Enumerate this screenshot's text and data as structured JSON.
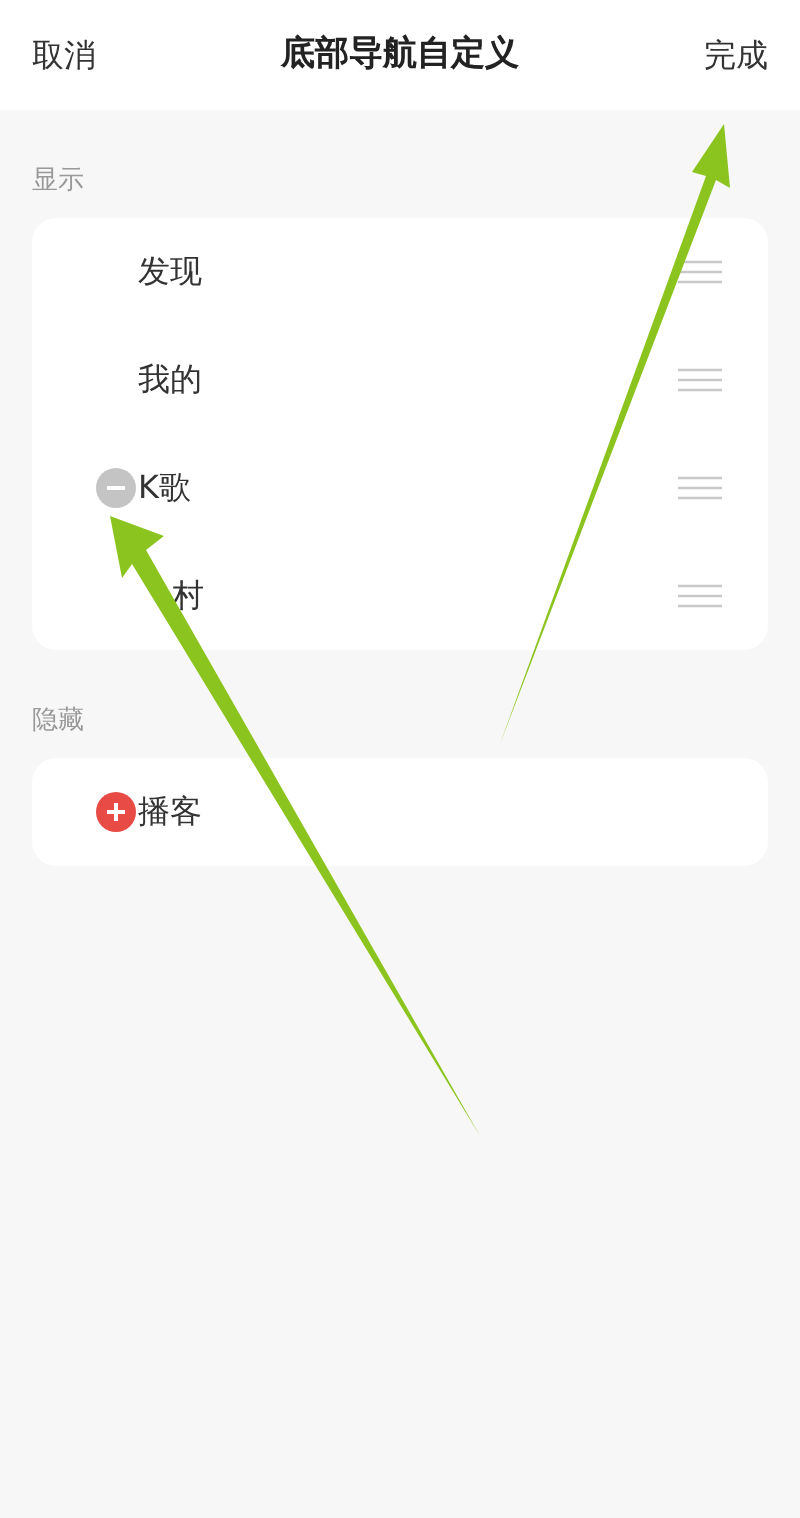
{
  "header": {
    "cancel": "取消",
    "title": "底部导航自定义",
    "done": "完成"
  },
  "sections": [
    {
      "label": "显示",
      "items": [
        {
          "label": "发现",
          "kind": "plain"
        },
        {
          "label": "我的",
          "kind": "plain"
        },
        {
          "label": "K歌",
          "kind": "removable"
        },
        {
          "label": "村",
          "kind": "covered"
        }
      ]
    },
    {
      "label": "隐藏",
      "items": [
        {
          "label": "播客",
          "kind": "addable"
        }
      ]
    }
  ]
}
